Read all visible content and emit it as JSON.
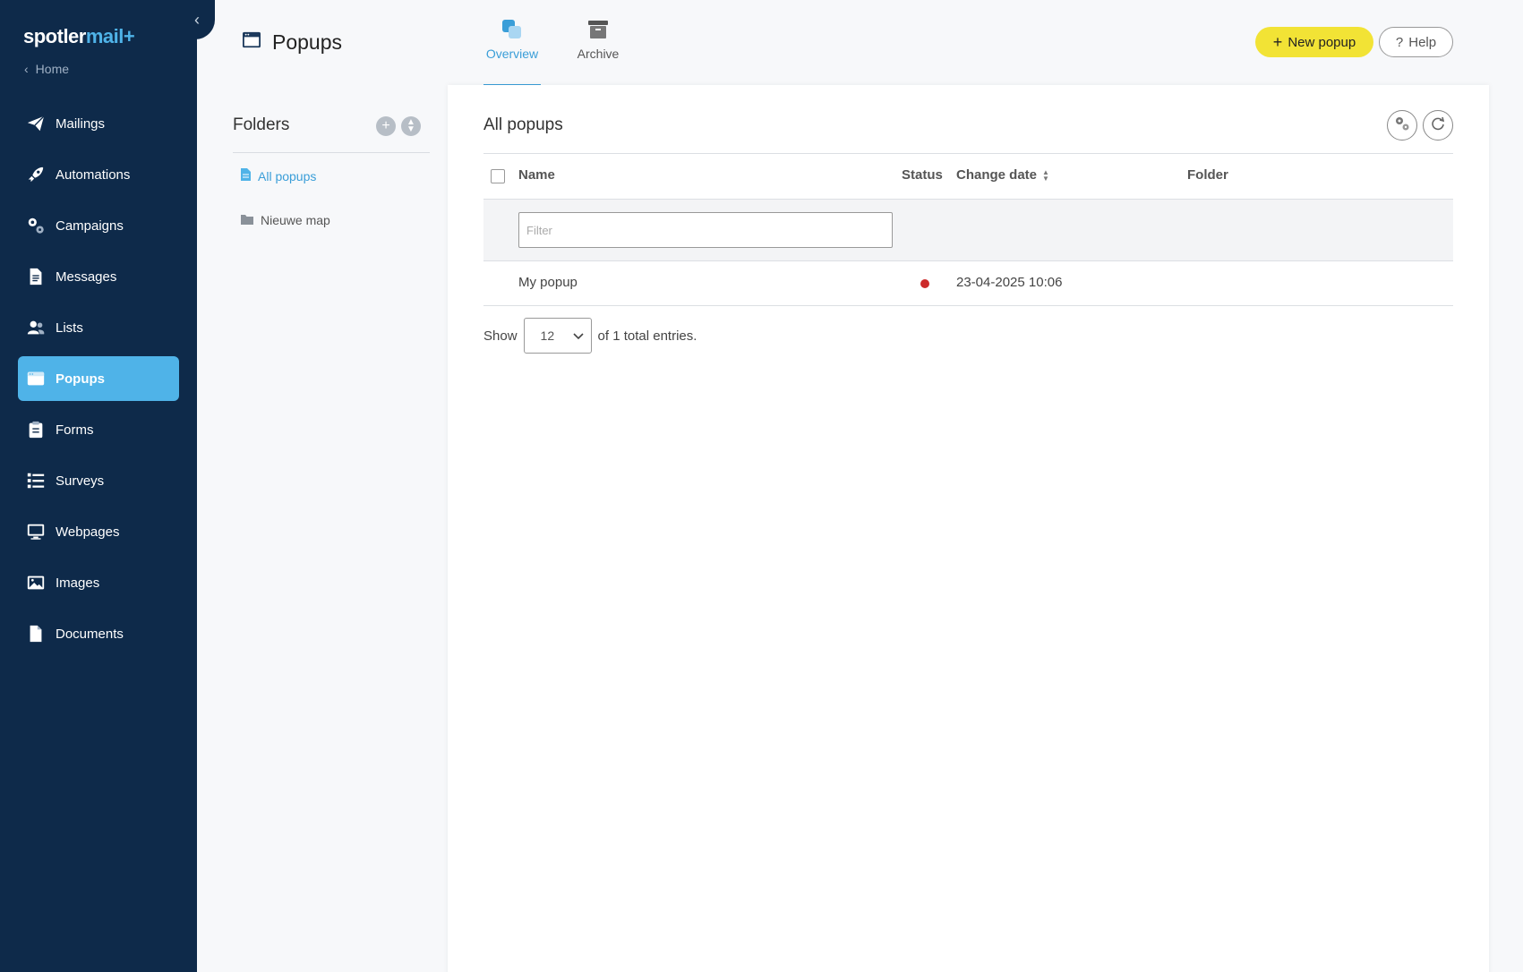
{
  "sidebar": {
    "brand_main": "spotler",
    "brand_accent": "mail+",
    "home_label": "Home",
    "items": [
      {
        "label": "Mailings",
        "icon": "paper-plane-icon"
      },
      {
        "label": "Automations",
        "icon": "rocket-icon"
      },
      {
        "label": "Campaigns",
        "icon": "gears-icon"
      },
      {
        "label": "Messages",
        "icon": "document-icon"
      },
      {
        "label": "Lists",
        "icon": "users-icon"
      },
      {
        "label": "Popups",
        "icon": "window-icon",
        "active": true
      },
      {
        "label": "Forms",
        "icon": "clipboard-icon"
      },
      {
        "label": "Surveys",
        "icon": "list-check-icon"
      },
      {
        "label": "Webpages",
        "icon": "monitor-icon"
      },
      {
        "label": "Images",
        "icon": "image-icon"
      },
      {
        "label": "Documents",
        "icon": "file-icon"
      }
    ]
  },
  "header": {
    "title": "Popups",
    "tabs": [
      {
        "label": "Overview",
        "icon": "overview-icon",
        "active": true
      },
      {
        "label": "Archive",
        "icon": "archive-icon",
        "active": false
      }
    ],
    "new_button": "New popup",
    "help_button": "Help"
  },
  "folders": {
    "title": "Folders",
    "items": [
      {
        "label": "All popups",
        "icon": "document-icon",
        "active": true
      },
      {
        "label": "Nieuwe map",
        "icon": "folder-icon",
        "active": false
      }
    ]
  },
  "main": {
    "title": "All popups",
    "columns": {
      "name": "Name",
      "status": "Status",
      "change_date": "Change date",
      "folder": "Folder"
    },
    "filter_placeholder": "Filter",
    "rows": [
      {
        "name": "My popup",
        "status": "inactive",
        "status_color": "#cc2b2b",
        "change_date": "23-04-2025 10:06",
        "folder": ""
      }
    ],
    "pager": {
      "show_label": "Show",
      "page_size": "12",
      "total_text": "of 1 total entries."
    }
  },
  "colors": {
    "sidebar_bg": "#0e2a4a",
    "accent": "#4fb3e8",
    "new_button_bg": "#f2e335"
  }
}
